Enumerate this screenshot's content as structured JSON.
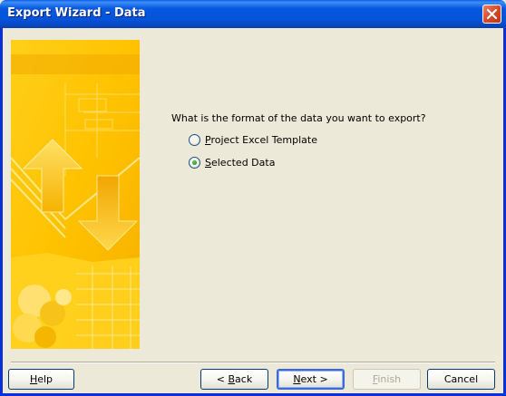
{
  "window": {
    "title": "Export Wizard - Data"
  },
  "main": {
    "question": "What is the format of the data you want to export?",
    "options": [
      {
        "label_accel": "P",
        "label_rest": "roject Excel Template",
        "selected": false
      },
      {
        "label_accel": "S",
        "label_rest": "elected Data",
        "selected": true
      }
    ]
  },
  "buttons": {
    "help": {
      "accel": "H",
      "rest": "elp",
      "enabled": true
    },
    "back": {
      "prefix": "< ",
      "accel": "B",
      "rest": "ack",
      "enabled": true
    },
    "next": {
      "accel": "N",
      "rest": "ext >",
      "enabled": true,
      "default": true
    },
    "finish": {
      "accel": "F",
      "rest": "inish",
      "enabled": false
    },
    "cancel": {
      "label": "Cancel",
      "enabled": true
    }
  },
  "colors": {
    "title_bar": "#0553d8",
    "dialog_bg": "#ece9d8",
    "side_image_primary": "#ffc400",
    "radio_selected_dot": "#21a121"
  }
}
